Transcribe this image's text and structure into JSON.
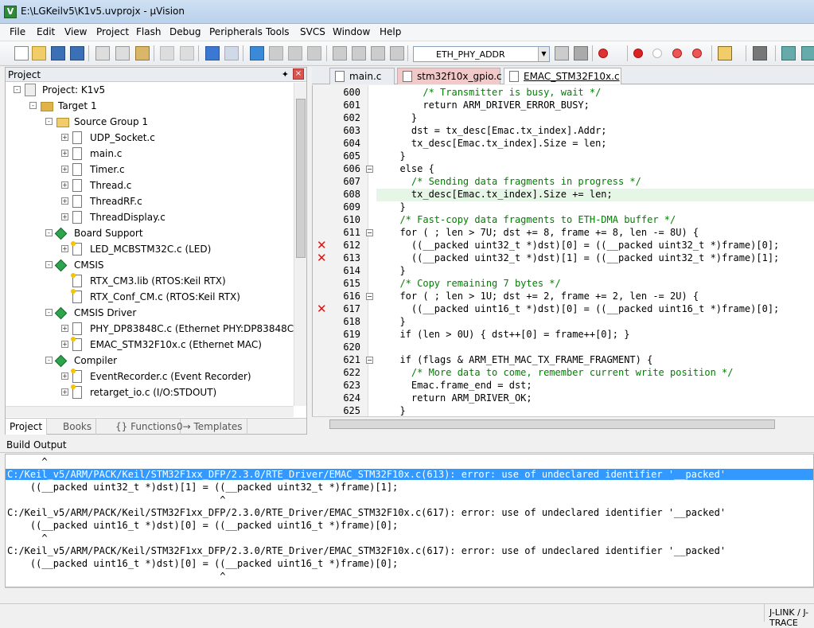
{
  "window": {
    "title": "E:\\LGKeilv5\\K1v5.uvprojx - µVision"
  },
  "menu": [
    "File",
    "Edit",
    "View",
    "Project",
    "Flash",
    "Debug",
    "Peripherals",
    "Tools",
    "SVCS",
    "Window",
    "Help"
  ],
  "toolbar": {
    "target_value": "ETH_PHY_ADDR"
  },
  "project_panel": {
    "title": "Project",
    "tree": [
      {
        "label": "Project: K1v5",
        "icon": "project",
        "indent": 0,
        "exp": "-"
      },
      {
        "label": "Target 1",
        "icon": "target",
        "indent": 1,
        "exp": "-"
      },
      {
        "label": "Source Group 1",
        "icon": "folder",
        "indent": 2,
        "exp": "-"
      },
      {
        "label": "UDP_Socket.c",
        "icon": "doc",
        "indent": 3,
        "exp": "+"
      },
      {
        "label": "main.c",
        "icon": "doc",
        "indent": 3,
        "exp": "+"
      },
      {
        "label": "Timer.c",
        "icon": "doc",
        "indent": 3,
        "exp": "+"
      },
      {
        "label": "Thread.c",
        "icon": "doc",
        "indent": 3,
        "exp": "+"
      },
      {
        "label": "ThreadRF.c",
        "icon": "doc",
        "indent": 3,
        "exp": "+"
      },
      {
        "label": "ThreadDisplay.c",
        "icon": "doc",
        "indent": 3,
        "exp": "+"
      },
      {
        "label": "Board Support",
        "icon": "diamond",
        "indent": 2,
        "exp": "-"
      },
      {
        "label": "LED_MCBSTM32C.c (LED)",
        "icon": "doc-star",
        "indent": 3,
        "exp": "+"
      },
      {
        "label": "CMSIS",
        "icon": "diamond",
        "indent": 2,
        "exp": "-"
      },
      {
        "label": "RTX_CM3.lib (RTOS:Keil RTX)",
        "icon": "doc-star",
        "indent": 3,
        "exp": ""
      },
      {
        "label": "RTX_Conf_CM.c (RTOS:Keil RTX)",
        "icon": "doc-star",
        "indent": 3,
        "exp": ""
      },
      {
        "label": "CMSIS Driver",
        "icon": "diamond",
        "indent": 2,
        "exp": "-"
      },
      {
        "label": "PHY_DP83848C.c (Ethernet PHY:DP83848C)",
        "icon": "doc",
        "indent": 3,
        "exp": "+"
      },
      {
        "label": "EMAC_STM32F10x.c (Ethernet MAC)",
        "icon": "doc-star",
        "indent": 3,
        "exp": "+"
      },
      {
        "label": "Compiler",
        "icon": "diamond",
        "indent": 2,
        "exp": "-"
      },
      {
        "label": "EventRecorder.c (Event Recorder)",
        "icon": "doc-star",
        "indent": 3,
        "exp": "+"
      },
      {
        "label": "retarget_io.c (I/O:STDOUT)",
        "icon": "doc-star",
        "indent": 3,
        "exp": "+"
      }
    ],
    "tabs": [
      "Project",
      "Books",
      "{} Functions",
      "0→ Templates"
    ]
  },
  "editor": {
    "tabs": [
      {
        "label": "main.c",
        "active": false,
        "color": "#e9edf2"
      },
      {
        "label": "stm32f10x_gpio.c",
        "active": false,
        "color": "#f2c9c9"
      },
      {
        "label": "EMAC_STM32F10x.c",
        "active": true,
        "color": "#e8d3ee"
      }
    ],
    "lines": [
      {
        "n": "600",
        "code": "      /* Transmitter is busy, wait */",
        "cls": "cmt"
      },
      {
        "n": "601",
        "code": "      return ARM_DRIVER_ERROR_BUSY;",
        "cls": ""
      },
      {
        "n": "602",
        "code": "    }",
        "cls": ""
      },
      {
        "n": "603",
        "code": "    dst = tx_desc[Emac.tx_index].Addr;",
        "cls": ""
      },
      {
        "n": "604",
        "code": "    tx_desc[Emac.tx_index].Size = len;",
        "cls": ""
      },
      {
        "n": "605",
        "code": "  }",
        "cls": ""
      },
      {
        "n": "606",
        "code": "  else {",
        "cls": ""
      },
      {
        "n": "607",
        "code": "    /* Sending data fragments in progress */",
        "cls": "cmt"
      },
      {
        "n": "608",
        "code": "    tx_desc[Emac.tx_index].Size += len;",
        "cls": ""
      },
      {
        "n": "609",
        "code": "  }",
        "cls": ""
      },
      {
        "n": "610",
        "code": "  /* Fast-copy data fragments to ETH-DMA buffer */",
        "cls": "cmt"
      },
      {
        "n": "611",
        "code": "  for ( ; len > 7U; dst += 8, frame += 8, len -= 8U) {",
        "cls": ""
      },
      {
        "n": "612",
        "code": "    ((__packed uint32_t *)dst)[0] = ((__packed uint32_t *)frame)[0];",
        "cls": ""
      },
      {
        "n": "613",
        "code": "    ((__packed uint32_t *)dst)[1] = ((__packed uint32_t *)frame)[1];",
        "cls": ""
      },
      {
        "n": "614",
        "code": "  }",
        "cls": ""
      },
      {
        "n": "615",
        "code": "  /* Copy remaining 7 bytes */",
        "cls": "cmt"
      },
      {
        "n": "616",
        "code": "  for ( ; len > 1U; dst += 2, frame += 2, len -= 2U) {",
        "cls": ""
      },
      {
        "n": "617",
        "code": "    ((__packed uint16_t *)dst)[0] = ((__packed uint16_t *)frame)[0];",
        "cls": ""
      },
      {
        "n": "618",
        "code": "  }",
        "cls": ""
      },
      {
        "n": "619",
        "code": "  if (len > 0U) { dst++[0] = frame++[0]; }",
        "cls": ""
      },
      {
        "n": "620",
        "code": "",
        "cls": ""
      },
      {
        "n": "621",
        "code": "  if (flags & ARM_ETH_MAC_TX_FRAME_FRAGMENT) {",
        "cls": ""
      },
      {
        "n": "622",
        "code": "    /* More data to come, remember current write position */",
        "cls": "cmt"
      },
      {
        "n": "623",
        "code": "    Emac.frame_end = dst;",
        "cls": ""
      },
      {
        "n": "624",
        "code": "    return ARM_DRIVER_OK;",
        "cls": ""
      },
      {
        "n": "625",
        "code": "  }",
        "cls": ""
      }
    ],
    "error_lines": [
      "612",
      "613",
      "617"
    ],
    "fold_lines": [
      "606",
      "611",
      "616",
      "621"
    ],
    "highlight_line": "608"
  },
  "build_output": {
    "title": "Build Output",
    "lines": [
      {
        "text": "      ^",
        "selected": false
      },
      {
        "text": "C:/Keil_v5/ARM/PACK/Keil/STM32F1xx_DFP/2.3.0/RTE_Driver/EMAC_STM32F10x.c(613): error: use of undeclared identifier '__packed'",
        "selected": true
      },
      {
        "text": "    ((__packed uint32_t *)dst)[1] = ((__packed uint32_t *)frame)[1];",
        "selected": false
      },
      {
        "text": "                                     ^",
        "selected": false
      },
      {
        "text": "C:/Keil_v5/ARM/PACK/Keil/STM32F1xx_DFP/2.3.0/RTE_Driver/EMAC_STM32F10x.c(617): error: use of undeclared identifier '__packed'",
        "selected": false
      },
      {
        "text": "    ((__packed uint16_t *)dst)[0] = ((__packed uint16_t *)frame)[0];",
        "selected": false
      },
      {
        "text": "      ^",
        "selected": false
      },
      {
        "text": "C:/Keil_v5/ARM/PACK/Keil/STM32F1xx_DFP/2.3.0/RTE_Driver/EMAC_STM32F10x.c(617): error: use of undeclared identifier '__packed'",
        "selected": false
      },
      {
        "text": "    ((__packed uint16_t *)dst)[0] = ((__packed uint16_t *)frame)[0];",
        "selected": false
      },
      {
        "text": "                                     ^",
        "selected": false
      }
    ]
  },
  "status": {
    "debugger": "J-LINK / J-TRACE"
  }
}
